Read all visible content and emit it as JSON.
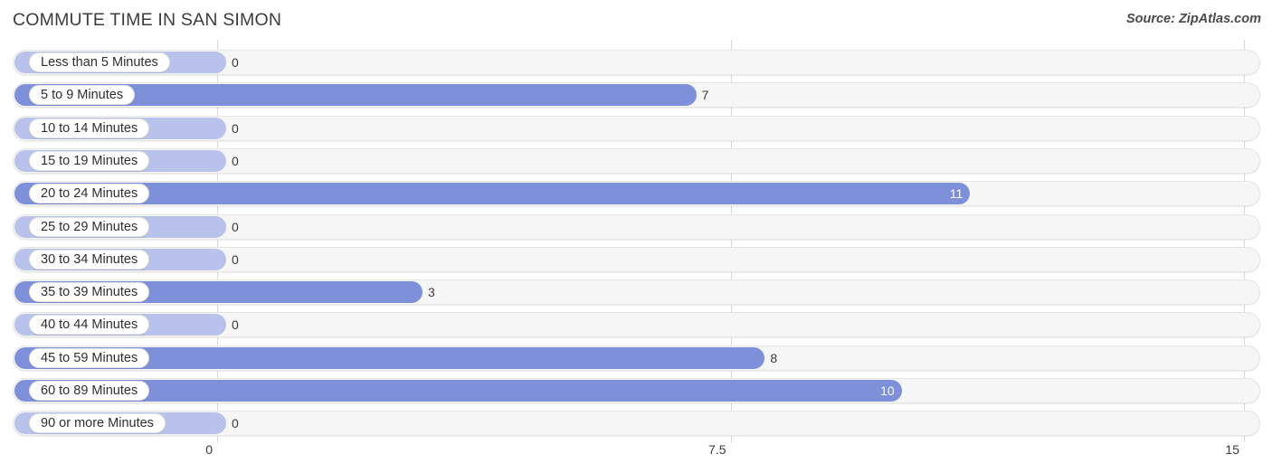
{
  "header": {
    "title": "COMMUTE TIME IN SAN SIMON",
    "source": "Source: ZipAtlas.com"
  },
  "axis": {
    "ticks": [
      "0",
      "7.5",
      "15"
    ]
  },
  "colors": {
    "bar": "#7f90db",
    "bar_zero": "#b9c2ea",
    "track": "#f6f6f6",
    "gridline": "#d9d9d9",
    "title_text": "#3c3c3c"
  },
  "chart_data": {
    "type": "bar",
    "orientation": "horizontal",
    "title": "COMMUTE TIME IN SAN SIMON",
    "subtitle": "",
    "xlabel": "",
    "ylabel": "",
    "xlim": [
      0,
      15
    ],
    "xticks": [
      0,
      7.5,
      15
    ],
    "grid": true,
    "legend": null,
    "source": "Source: ZipAtlas.com",
    "categories": [
      "Less than 5 Minutes",
      "5 to 9 Minutes",
      "10 to 14 Minutes",
      "15 to 19 Minutes",
      "20 to 24 Minutes",
      "25 to 29 Minutes",
      "30 to 34 Minutes",
      "35 to 39 Minutes",
      "40 to 44 Minutes",
      "45 to 59 Minutes",
      "60 to 89 Minutes",
      "90 or more Minutes"
    ],
    "values": [
      0,
      7,
      0,
      0,
      11,
      0,
      0,
      3,
      0,
      8,
      10,
      0
    ],
    "value_labels": [
      "0",
      "7",
      "0",
      "0",
      "11",
      "0",
      "0",
      "3",
      "0",
      "8",
      "10",
      "0"
    ],
    "rows": [
      {
        "label": "Less than 5 Minutes",
        "value": 0,
        "value_label": "0"
      },
      {
        "label": "5 to 9 Minutes",
        "value": 7,
        "value_label": "7"
      },
      {
        "label": "10 to 14 Minutes",
        "value": 0,
        "value_label": "0"
      },
      {
        "label": "15 to 19 Minutes",
        "value": 0,
        "value_label": "0"
      },
      {
        "label": "20 to 24 Minutes",
        "value": 11,
        "value_label": "11"
      },
      {
        "label": "25 to 29 Minutes",
        "value": 0,
        "value_label": "0"
      },
      {
        "label": "30 to 34 Minutes",
        "value": 0,
        "value_label": "0"
      },
      {
        "label": "35 to 39 Minutes",
        "value": 3,
        "value_label": "3"
      },
      {
        "label": "40 to 44 Minutes",
        "value": 0,
        "value_label": "0"
      },
      {
        "label": "45 to 59 Minutes",
        "value": 8,
        "value_label": "8"
      },
      {
        "label": "60 to 89 Minutes",
        "value": 10,
        "value_label": "10"
      },
      {
        "label": "90 or more Minutes",
        "value": 0,
        "value_label": "0"
      }
    ]
  }
}
